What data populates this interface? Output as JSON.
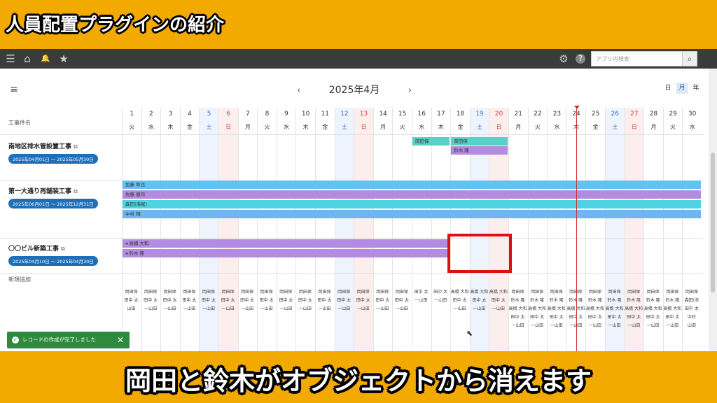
{
  "video": {
    "title": "人員配置プラグインの紹介",
    "caption": "岡田と鈴木がオブジェクトから消えます"
  },
  "topbar": {
    "menu_icon": "☰",
    "home_icon": "⌂",
    "bell_icon": "🔔",
    "star_icon": "★",
    "gear_icon": "⚙",
    "help_icon": "?",
    "search_placeholder": "アプリ内検索",
    "search_icon": "🔍"
  },
  "calendar": {
    "month_label": "2025年4月",
    "prev": "‹",
    "next": "›",
    "views": [
      "日",
      "月",
      "年"
    ],
    "active_view": "月",
    "column_header": "工事件名",
    "days": [
      {
        "d": "1",
        "w": "火"
      },
      {
        "d": "2",
        "w": "水"
      },
      {
        "d": "3",
        "w": "木"
      },
      {
        "d": "4",
        "w": "金"
      },
      {
        "d": "5",
        "w": "土"
      },
      {
        "d": "6",
        "w": "日"
      },
      {
        "d": "7",
        "w": "月"
      },
      {
        "d": "8",
        "w": "火"
      },
      {
        "d": "9",
        "w": "水"
      },
      {
        "d": "10",
        "w": "木"
      },
      {
        "d": "11",
        "w": "金"
      },
      {
        "d": "12",
        "w": "土"
      },
      {
        "d": "13",
        "w": "日"
      },
      {
        "d": "14",
        "w": "月"
      },
      {
        "d": "15",
        "w": "火"
      },
      {
        "d": "16",
        "w": "水"
      },
      {
        "d": "17",
        "w": "木"
      },
      {
        "d": "18",
        "w": "金"
      },
      {
        "d": "19",
        "w": "土"
      },
      {
        "d": "20",
        "w": "日"
      },
      {
        "d": "21",
        "w": "月"
      },
      {
        "d": "22",
        "w": "火"
      },
      {
        "d": "23",
        "w": "水"
      },
      {
        "d": "24",
        "w": "木"
      },
      {
        "d": "25",
        "w": "金"
      },
      {
        "d": "26",
        "w": "土"
      },
      {
        "d": "27",
        "w": "日"
      },
      {
        "d": "28",
        "w": "月"
      },
      {
        "d": "29",
        "w": "火"
      },
      {
        "d": "30",
        "w": "水"
      }
    ],
    "projects": [
      {
        "name": "南地区排水管設置工事",
        "ext": "⧉",
        "dates": "2025年04月01日 〜 2025年05月30日"
      },
      {
        "name": "第一大通り再舗装工事",
        "ext": "⧉",
        "dates": "2025年06月01日 〜 2025年12月31日"
      },
      {
        "name": "〇〇ビル新築工事",
        "ext": "⧉",
        "dates": "2025年04月10日 〜 2025年04月30日"
      }
    ],
    "bars": [
      {
        "label": "岡田保",
        "color": "teal",
        "start": 16,
        "end": 17,
        "row": 0
      },
      {
        "label": "岡田保",
        "color": "teal",
        "start": 18,
        "end": 20,
        "row": 0
      },
      {
        "label": "鈴木 隆",
        "color": "purple",
        "start": 18,
        "end": 20,
        "row": 1
      },
      {
        "label": "加藤 和也",
        "color": "blue",
        "start": 1,
        "end": 30,
        "row": 2
      },
      {
        "label": "佐藤 健司",
        "color": "purple",
        "start": 1,
        "end": 30,
        "row": 3
      },
      {
        "label": "森田(海尾)",
        "color": "cyan",
        "start": 1,
        "end": 30,
        "row": 4
      },
      {
        "label": "中村 翔",
        "color": "lblue",
        "start": 1,
        "end": 30,
        "row": 5
      },
      {
        "label": "◂ 高橋 大和",
        "color": "purple",
        "start": 1,
        "end": 17,
        "row": 6
      },
      {
        "label": "◂ 鈴木 隆",
        "color": "purple",
        "start": 1,
        "end": 17,
        "row": 7
      }
    ],
    "new_add_label": "新規追加",
    "cells": [
      [
        "岡田保",
        "岡田保",
        "岡田保",
        "岡田保",
        "岡田保",
        "岡田保",
        "岡田保",
        "岡田保",
        "岡田保",
        "岡田保",
        "岡田保",
        "岡田保",
        "岡田保",
        "岡田保",
        "岡田保",
        "田中 太",
        "田中 太",
        "高橋 大和",
        "高橋 大和",
        "高橋 大和",
        "岡田保",
        "岡田保",
        "岡田保",
        "岡田保",
        "岡田保",
        "岡田保",
        "岡田保",
        "岡田保",
        "岡田保",
        "岡田保"
      ],
      [
        "田中 太",
        "田中 太",
        "田中 太",
        "田中 太",
        "田中 太",
        "田中 太",
        "田中 太",
        "田中 太",
        "田中 太",
        "田中 太",
        "田中 太",
        "田中 太",
        "田中 太",
        "田中 太",
        "田中 太",
        "一山田",
        "一山田",
        "田中 太",
        "田中 太",
        "田中 太",
        "鈴木 隆",
        "鈴木 隆",
        "鈴木 隆",
        "鈴木 隆",
        "鈴木 隆",
        "鈴木 隆",
        "鈴木 隆",
        "鈴木 隆",
        "鈴木 隆",
        "森田(海"
      ],
      [
        "山田",
        "一山田",
        "一山田",
        "一山田",
        "一山田",
        "一山田",
        "一山田",
        "一山田",
        "一山田",
        "一山田",
        "一山田",
        "一山田",
        "一山田",
        "一山田",
        "一山田",
        "",
        "",
        "一山田",
        "一山田",
        "一山田",
        "高橋 大和",
        "高橋 大和",
        "高橋 大和",
        "高橋 大和",
        "高橋 大和",
        "高橋 大和",
        "高橋 大和",
        "高橋 大和",
        "高橋 大和",
        "田中 太"
      ],
      [
        "",
        "",
        "",
        "",
        "",
        "",
        "",
        "",
        "",
        "",
        "",
        "",
        "",
        "",
        "",
        "",
        "",
        "",
        "",
        "",
        "田中 太",
        "田中 太",
        "田中 太",
        "田中 太",
        "田中 太",
        "田中 太",
        "田中 太",
        "田中 太",
        "田中 太",
        "中村"
      ],
      [
        "",
        "",
        "",
        "",
        "",
        "",
        "",
        "",
        "",
        "",
        "",
        "",
        "",
        "",
        "",
        "",
        "",
        "",
        "",
        "",
        "一山田",
        "一山田",
        "一山田",
        "一山田",
        "一山田",
        "一山田",
        "一山田",
        "一山田",
        "一山田",
        "山田"
      ]
    ],
    "today_day": 25
  },
  "toast": {
    "message": "レコードの作成が完了しました",
    "close": "✕",
    "check": "✓"
  },
  "colors": {
    "frame": "#f2a900",
    "topbar": "#3b3b3b",
    "highlight": "#e01010",
    "today": "#d03030"
  }
}
